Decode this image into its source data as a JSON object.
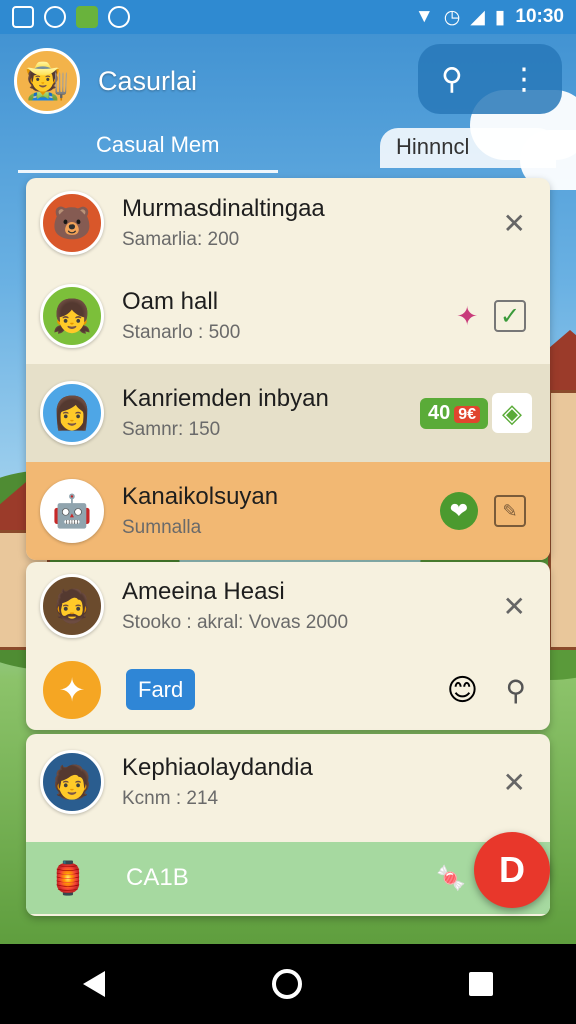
{
  "status": {
    "time": "10:30"
  },
  "header": {
    "title": "Casurlai",
    "avatar_glyph": "🧑‍🌾",
    "search_glyph": "⚲",
    "menu_glyph": "⋮"
  },
  "tabs": [
    {
      "label": "Casual Mem"
    },
    {
      "label": "Hinnncl"
    }
  ],
  "items": [
    {
      "name": "Murmasdinaltingaa",
      "sub": "Samarlia: 200",
      "avatar_glyph": "🐻",
      "avatar_bg": "#d9572a"
    },
    {
      "name": "Oam hall",
      "sub": "Stanarlo : 500",
      "avatar_glyph": "👧",
      "avatar_bg": "#7cbf3a"
    },
    {
      "name": "Kanriemden inbyan",
      "sub": "Samnr: 150",
      "avatar_glyph": "👩",
      "avatar_bg": "#4ea6e6",
      "badge": "40",
      "badge_red": "9€"
    },
    {
      "name": "Kanaikolsuyan",
      "sub": "Sumnalla",
      "avatar_glyph": "🤖",
      "avatar_bg": "#ffffff"
    },
    {
      "name": "Ameeina Heasi",
      "sub": "Stooko : akral: Vovas 2000",
      "avatar_glyph": "🧔",
      "avatar_bg": "#6b4b2d"
    },
    {
      "name": "Kephiaolaydandia",
      "sub": "Kcnm : 214",
      "avatar_glyph": "🧑",
      "avatar_bg": "#2a5d8f"
    }
  ],
  "farm_button": {
    "label": "Fard"
  },
  "bottom_bar": {
    "label": "CA1B"
  },
  "fab": {
    "label": "D"
  },
  "colors": {
    "status": "#2f8ad1",
    "card": "#f6f1df",
    "highlight_gray": "#e6e0c9",
    "highlight_orange": "#f2b873",
    "bottom_green": "#a6d9a0",
    "fab": "#e8372b"
  }
}
